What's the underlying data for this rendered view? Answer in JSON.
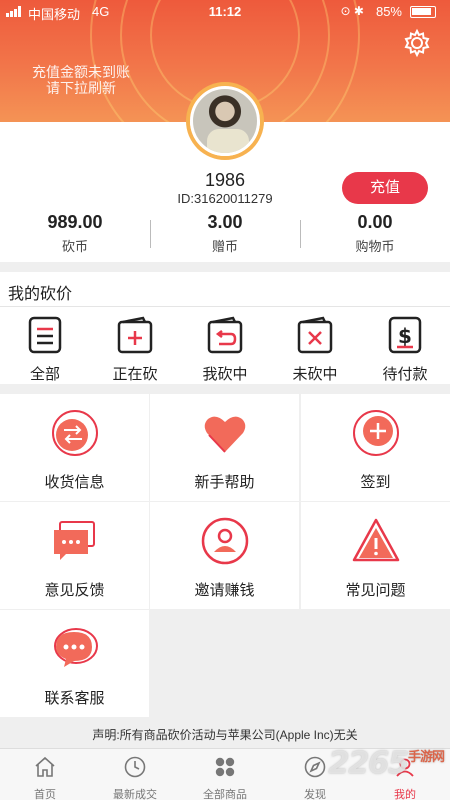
{
  "status_bar": {
    "carrier": "中国移动",
    "network": "4G",
    "time": "11:12",
    "battery": "85%"
  },
  "header": {
    "notice": "充值金额未到账\n请下拉刷新"
  },
  "profile": {
    "name": "1986",
    "id": "ID:31620011279",
    "recharge_label": "充值"
  },
  "balances": [
    {
      "value": "989.00",
      "label": "砍币"
    },
    {
      "value": "3.00",
      "label": "赠币"
    },
    {
      "value": "0.00",
      "label": "购物币"
    }
  ],
  "orders": {
    "title": "我的砍价",
    "items": [
      {
        "label": "全部",
        "icon": "list-icon"
      },
      {
        "label": "正在砍",
        "icon": "wallet-plus-icon"
      },
      {
        "label": "我砍中",
        "icon": "wallet-return-icon"
      },
      {
        "label": "未砍中",
        "icon": "wallet-x-icon"
      },
      {
        "label": "待付款",
        "icon": "dollar-icon"
      }
    ]
  },
  "services": [
    {
      "label": "收货信息",
      "icon": "swap-arrows-icon"
    },
    {
      "label": "新手帮助",
      "icon": "heart-icon"
    },
    {
      "label": "签到",
      "icon": "plus-circle-icon"
    },
    {
      "label": "意见反馈",
      "icon": "chat-bubbles-icon"
    },
    {
      "label": "邀请赚钱",
      "icon": "person-icon"
    },
    {
      "label": "常见问题",
      "icon": "warning-icon"
    },
    {
      "label": "联系客服",
      "icon": "message-icon"
    }
  ],
  "disclaimer": "声明:所有商品砍价活动与苹果公司(Apple Inc)无关",
  "tabbar": [
    {
      "label": "首页",
      "icon": "home-icon"
    },
    {
      "label": "最新成交",
      "icon": "clock-icon"
    },
    {
      "label": "全部商品",
      "icon": "grid-icon"
    },
    {
      "label": "发现",
      "icon": "compass-icon"
    },
    {
      "label": "我的",
      "icon": "user-icon"
    }
  ],
  "watermark": {
    "text": "2265",
    "suffix": "手游网"
  },
  "colors": {
    "accent": "#e8384a",
    "header_top": "#ee5a3c",
    "header_bottom": "#f49355"
  }
}
